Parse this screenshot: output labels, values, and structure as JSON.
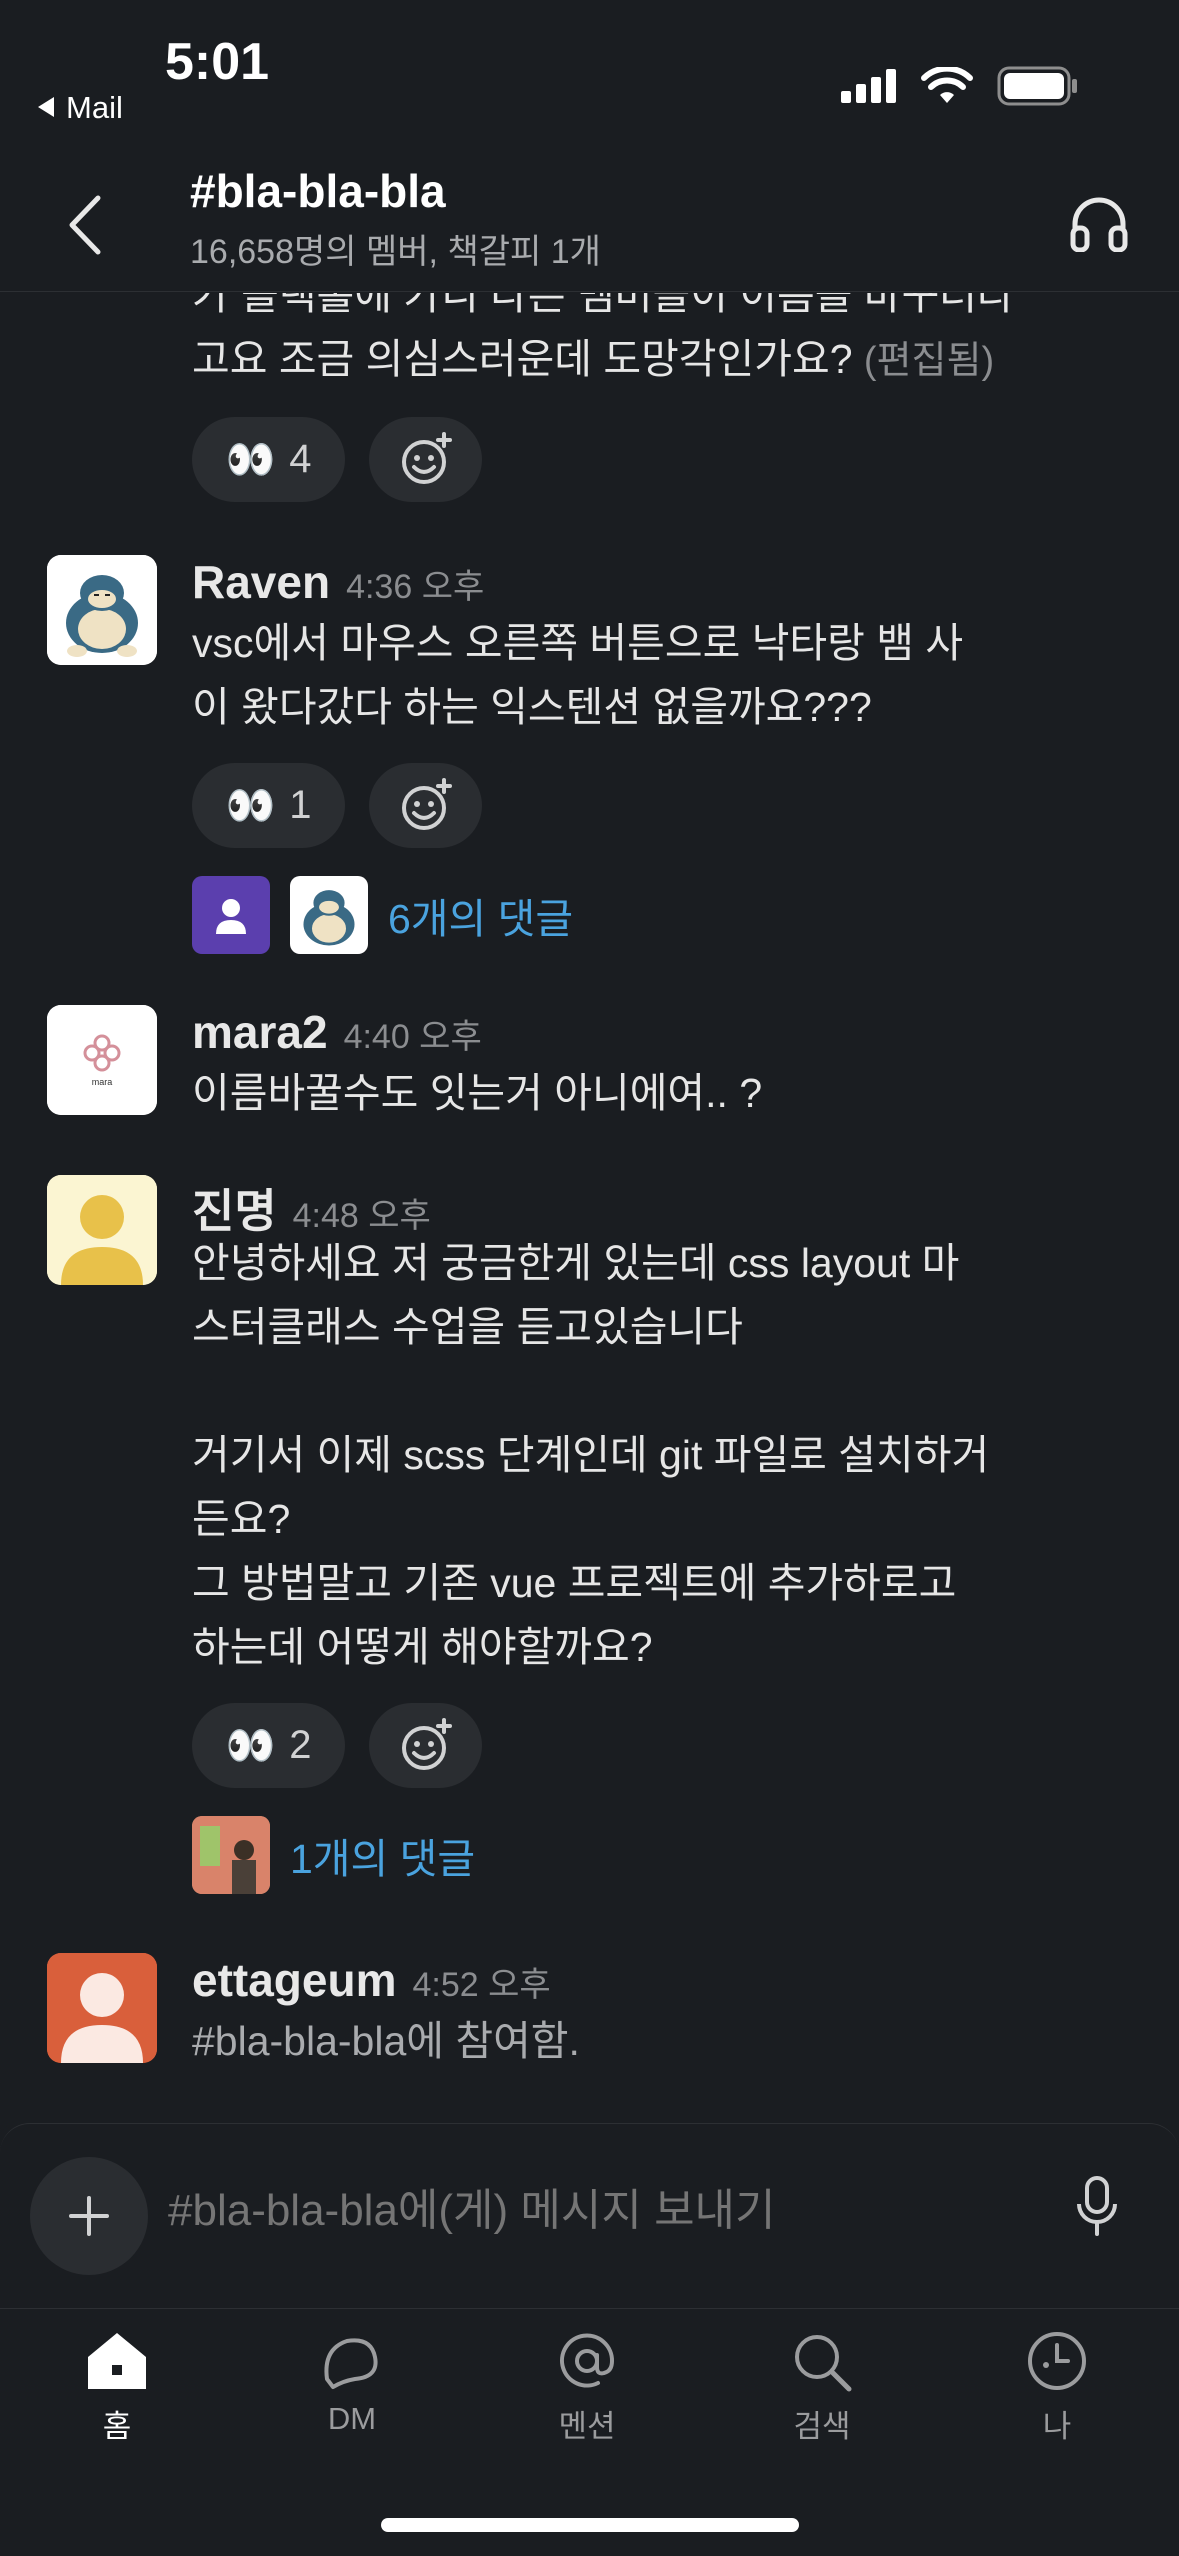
{
  "status": {
    "time": "5:01",
    "back_app": "Mail"
  },
  "header": {
    "title": "#bla-bla-bla",
    "subtitle": "16,658명의 멤버, 책갈피 1개"
  },
  "partial_message": {
    "line1": "가 블랙홀에 가니 다른 멤버들이 이름을 바꾸더라",
    "line2": "고요 조금 의심스러운데 도망각인가요?",
    "edited": "(편집됨)",
    "reaction_count": "4"
  },
  "messages": [
    {
      "name": "Raven",
      "time": "4:36 오후",
      "lines": [
        "vsc에서 마우스 오른쪽 버튼으로 낙타랑 뱀 사",
        "이 왔다갔다 하는 익스텐션 없을까요???"
      ],
      "reaction_count": "1",
      "thread_label": "6개의 댓글"
    },
    {
      "name": "mara2",
      "time": "4:40 오후",
      "lines": [
        "이름바꿀수도 잇는거 아니에여.. ?"
      ],
      "avatar_text": "mara"
    },
    {
      "name": "진명",
      "time": "4:48 오후",
      "lines": [
        "안녕하세요 저 궁금한게 있는데 css layout 마",
        "스터클래스 수업을 듣고있습니다",
        "",
        "거기서 이제 scss 단계인데 git 파일로 설치하거",
        "든요?",
        "그 방법말고 기존 vue 프로젝트에 추가하로고",
        "하는데 어떻게 해야할까요?"
      ],
      "reaction_count": "2",
      "thread_label": "1개의 댓글"
    },
    {
      "name": "ettageum",
      "time": "4:52 오후",
      "lines": [
        "#bla-bla-bla에 참여함."
      ]
    }
  ],
  "composer": {
    "placeholder": "#bla-bla-bla에(게) 메시지 보내기"
  },
  "tabs": [
    {
      "label": "홈",
      "icon": "home-icon"
    },
    {
      "label": "DM",
      "icon": "dm-icon"
    },
    {
      "label": "멘션",
      "icon": "mention-icon"
    },
    {
      "label": "검색",
      "icon": "search-icon"
    },
    {
      "label": "나",
      "icon": "profile-icon"
    }
  ],
  "colors": {
    "background": "#1a1d21",
    "link": "#4aa3df",
    "pill": "#2a2d31"
  }
}
